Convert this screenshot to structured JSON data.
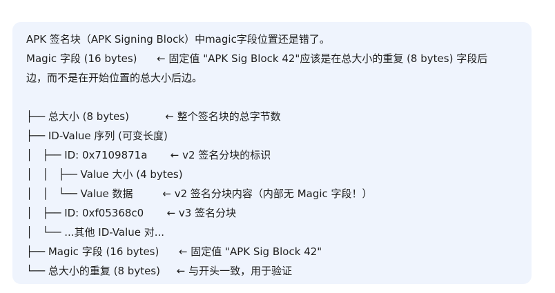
{
  "message": {
    "lines": [
      "APK 签名块（APK Signing Block）中magic字段位置还是错了。",
      "Magic 字段 (16 bytes)      ← 固定值 \"APK Sig Block 42\"应该是在总大小的重复 (8 bytes) 字段后",
      "边，而不是在开始位置的总大小后边。",
      "",
      "├── 总大小 (8 bytes)           ← 整个签名块的总字节数",
      "├── ID-Value 序列 (可变长度)",
      "│   ├── ID: 0x7109871a       ← v2 签名分块的标识",
      "│   │   ├── Value 大小 (4 bytes)",
      "│   │   └── Value 数据         ← v2 签名分块内容（内部无 Magic 字段！）",
      "│   ├── ID: 0xf05368c0       ← v3 签名分块",
      "│   └── ...其他 ID-Value 对...",
      "├── Magic 字段 (16 bytes)      ← 固定值 \"APK Sig Block 42\"",
      "└── 总大小的重复 (8 bytes)     ← 与开头一致，用于验证"
    ]
  },
  "colors": {
    "bubble_background": "#eff4fd",
    "text": "#1f1f1f",
    "page_background": "#ffffff"
  }
}
